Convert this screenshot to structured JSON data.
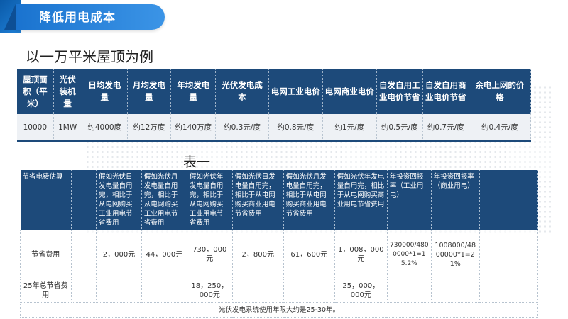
{
  "header": {
    "title": "降低用电成本"
  },
  "subtitle": "以一万平米屋顶为例",
  "table1": {
    "headers": [
      "屋顶面积（平米）",
      "光伏装机量",
      "日均发电量",
      "月均发电量",
      "年均发电量",
      "光伏发电成本",
      "电网工业电价",
      "电网商业电价",
      "自发自用工业电价节省",
      "自发自用商业电价节省",
      "余电上网的价格"
    ],
    "row": [
      "10000",
      "1MW",
      "约4000度",
      "约12万度",
      "约140万度",
      "约0.3元/度",
      "约0.8元/度",
      "约1元/度",
      "约0.5元/度",
      "约0.7元/度",
      "约0.4元/度"
    ]
  },
  "table_caption": "表一",
  "table2": {
    "headers": [
      "节省电费估算",
      "",
      "假如光伏日发电量自用完，相比于从电网购买工业用电节省费用",
      "假如光伏月发电量自用完，相比于从电网购买工业用电节省费用",
      "假如光伏年发电量自用完，相比于从电网购买工业用电节省费用",
      "假如光伏日发电量自用完，相比于从电网购买商业用电节省费用",
      "假如光伏月发电量自用完，相比于从电网购买商业用电节省费用",
      "假如光伏年发电量自用完，相比于从电网购买商业用电节省费用",
      "年投资回报率（工业用电）",
      "年投资回报率（商业用电）",
      ""
    ],
    "row_savings": [
      "节省费用",
      "",
      "2，000元",
      "44，000元",
      "730，000元",
      "2，800元",
      "61，600元",
      "1，008，000元",
      "730000/4800000*1=15.2%",
      "1008000/4800000*1=21%",
      ""
    ],
    "row_total": [
      "25年总节省费用",
      "",
      "",
      "",
      "18，250，000元",
      "",
      "",
      "25，000，000元",
      "",
      "",
      ""
    ],
    "note": "光伏发电系统使用年限大约是25-30年。"
  }
}
